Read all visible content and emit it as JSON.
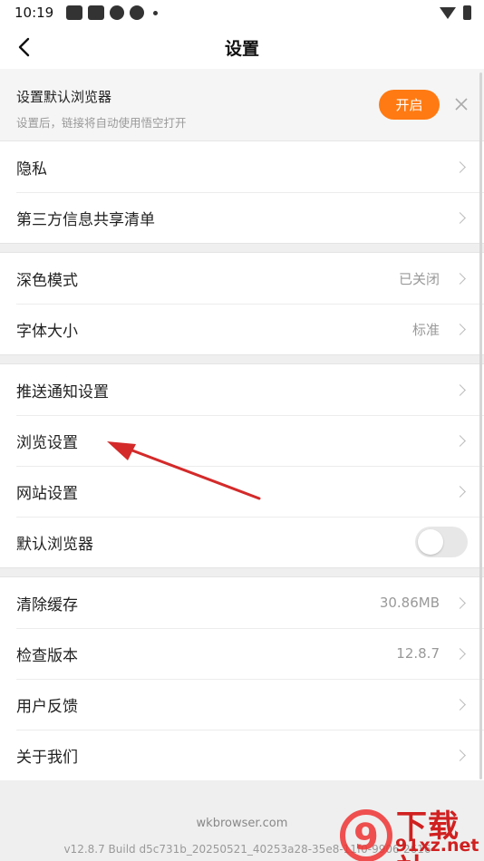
{
  "status_bar": {
    "time": "10:19"
  },
  "header": {
    "title": "设置"
  },
  "banner": {
    "title": "设置默认浏览器",
    "subtitle": "设置后，链接将自动使用悟空打开",
    "open_label": "开启"
  },
  "groups": {
    "g1": [
      {
        "label": "隐私"
      },
      {
        "label": "第三方信息共享清单"
      }
    ],
    "g2": [
      {
        "label": "深色模式",
        "value": "已关闭"
      },
      {
        "label": "字体大小",
        "value": "标准"
      }
    ],
    "g3": [
      {
        "label": "推送通知设置"
      },
      {
        "label": "浏览设置"
      },
      {
        "label": "网站设置"
      },
      {
        "label": "默认浏览器",
        "toggle": false
      }
    ],
    "g4": [
      {
        "label": "清除缓存",
        "value": "30.86MB"
      },
      {
        "label": "检查版本",
        "value": "12.8.7"
      },
      {
        "label": "用户反馈"
      },
      {
        "label": "关于我们"
      }
    ]
  },
  "footer": {
    "site": "wkbrowser.com",
    "build": "v12.8.7 Build d5c731b_20250521_40253a28-35e8-11f0-9906-2616"
  },
  "watermark": {
    "text": "下载站",
    "url": "91xz.net",
    "logo": "9"
  },
  "colors": {
    "accent": "#ff7a12",
    "annotation_arrow": "#d42a2a"
  }
}
